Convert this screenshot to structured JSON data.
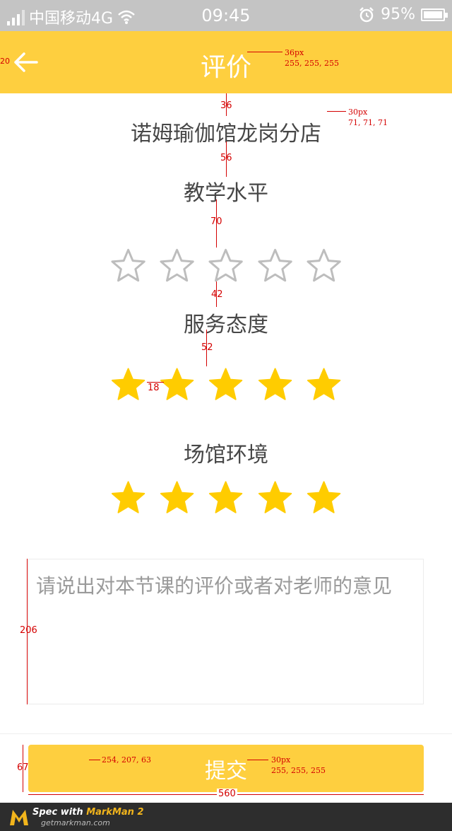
{
  "status_bar": {
    "carrier": "中国移动4G",
    "time": "09:45",
    "battery": "95%"
  },
  "header": {
    "title": "评价",
    "back_icon": "arrow-left-icon"
  },
  "venue_name": "诺姆瑜伽馆龙岗分店",
  "ratings": [
    {
      "label": "教学水平",
      "value": 0,
      "max": 5
    },
    {
      "label": "服务态度",
      "value": 5,
      "max": 5
    },
    {
      "label": "场馆环境",
      "value": 5,
      "max": 5
    }
  ],
  "comment": {
    "value": "",
    "placeholder": "请说出对本节课的评价或者对老师的意见"
  },
  "submit_label": "提交",
  "colors": {
    "accent": "#fecf3f",
    "title_text": "#ffffff",
    "body_text": "#474747",
    "star_filled": "#ffcc00",
    "star_empty": "#bdbdbd"
  },
  "spec_annotations": {
    "header_back_gap": "20",
    "title_font": "36px",
    "title_color": "255, 255, 255",
    "venue_font": "30px",
    "venue_color": "71, 71, 71",
    "gap_header_venue": "36",
    "gap_venue_label": "56",
    "gap_label_stars": "70",
    "gap_stars_label": "42",
    "gap_label_stars_2": "52",
    "star_gap": "18",
    "textarea_height": "206",
    "button_height": "67",
    "button_color": "254, 207, 63",
    "button_font": "30px",
    "button_text_color": "255, 255, 255",
    "button_width": "560"
  },
  "markman": {
    "line1_prefix": "Spec with ",
    "line1_brand": "MarkMan 2",
    "line2": "getmarkman.com"
  }
}
